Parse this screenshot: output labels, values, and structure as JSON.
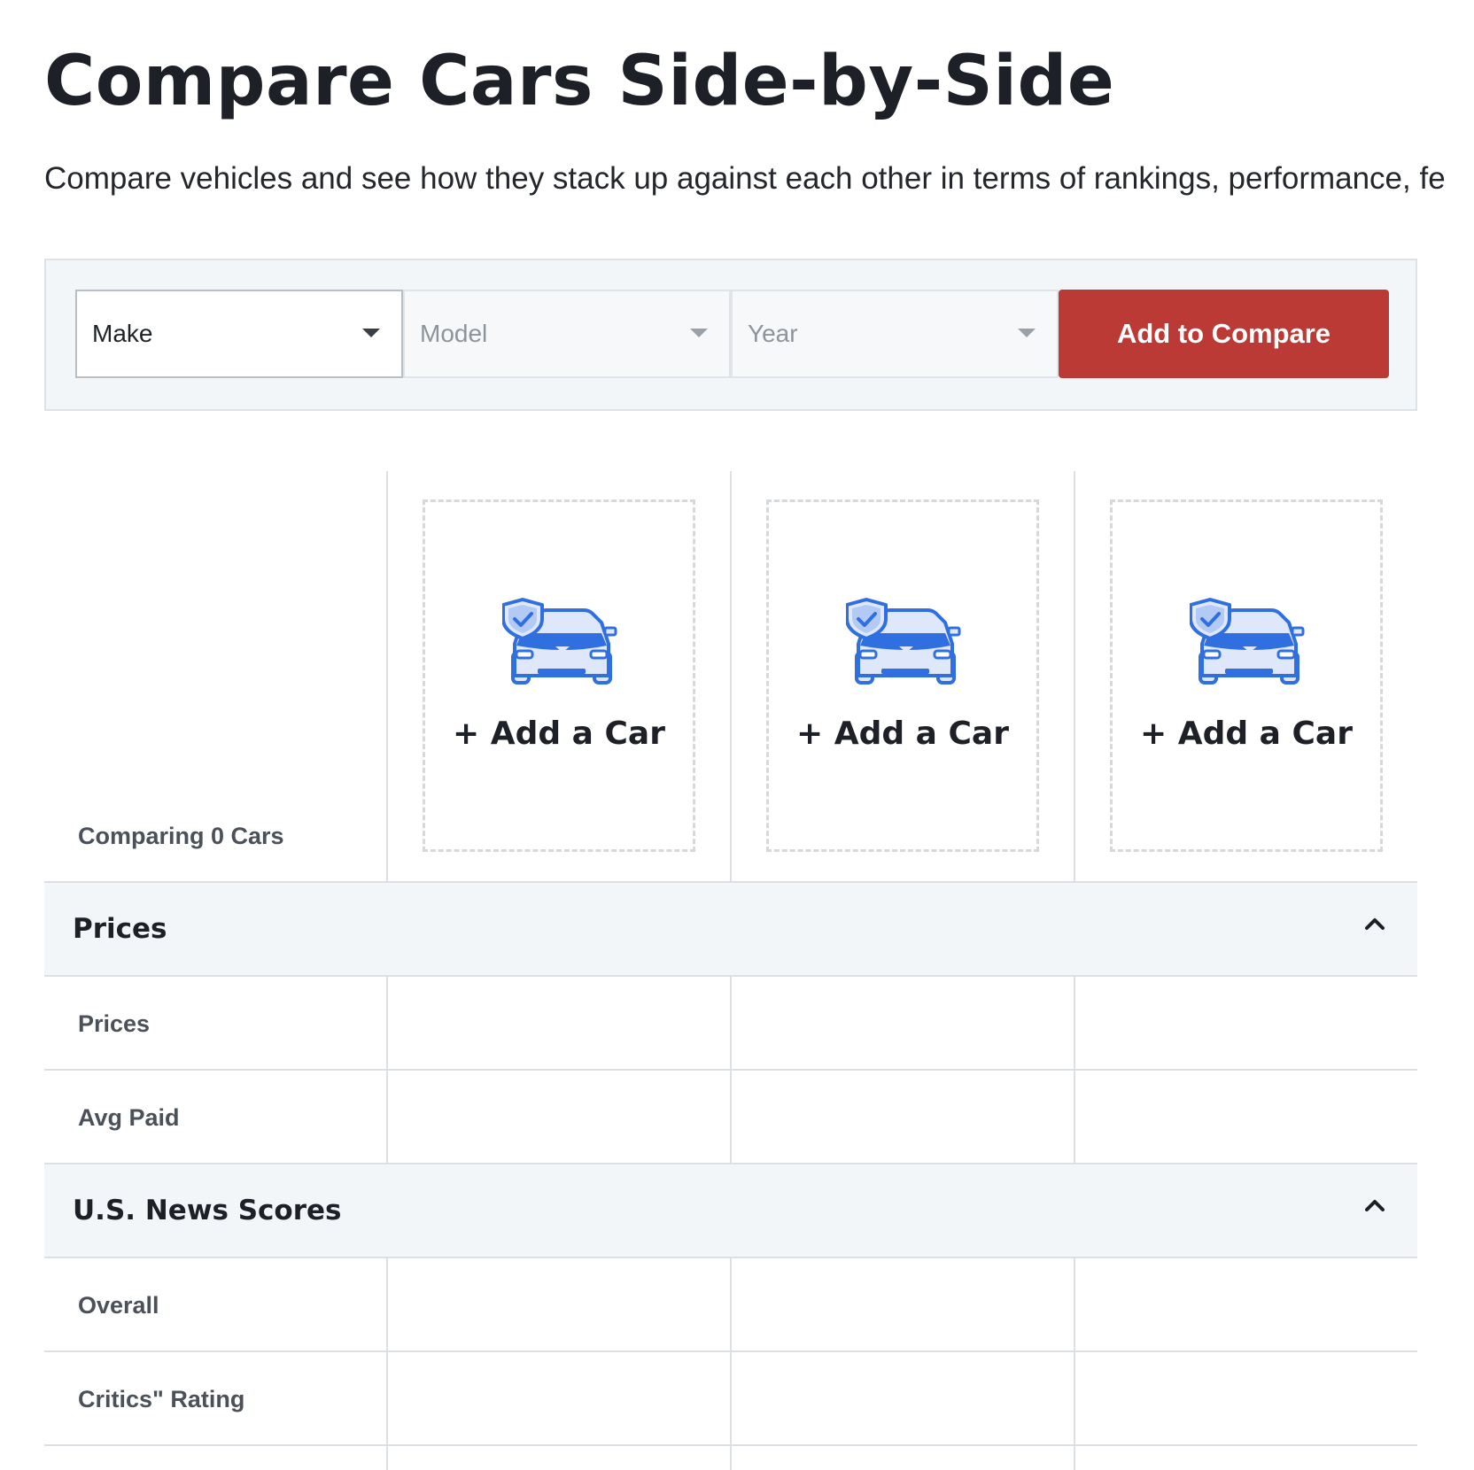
{
  "header": {
    "title": "Compare Cars Side-by-Side",
    "subtitle": "Compare vehicles and see how they stack up against each other in terms of rankings, performance, fe"
  },
  "selector": {
    "make": "Make",
    "model": "Model",
    "year": "Year",
    "add_button": "Add to Compare"
  },
  "comparison": {
    "count_label": "Comparing 0 Cars",
    "slots": [
      {
        "label": "+ Add a Car",
        "icon": "car-shield-icon"
      },
      {
        "label": "+ Add a Car",
        "icon": "car-shield-icon"
      },
      {
        "label": "+ Add a Car",
        "icon": "car-shield-icon"
      }
    ]
  },
  "sections": [
    {
      "title": "Prices",
      "rows": [
        {
          "label": "Prices"
        },
        {
          "label": "Avg Paid"
        }
      ]
    },
    {
      "title": "U.S. News Scores",
      "rows": [
        {
          "label": "Overall"
        },
        {
          "label": "Critics\" Rating"
        }
      ]
    }
  ],
  "colors": {
    "accent": "#bc3a36",
    "icon_blue": "#2f6fe0",
    "icon_light": "#dfe8fb",
    "panel_bg": "#f3f6f9"
  }
}
